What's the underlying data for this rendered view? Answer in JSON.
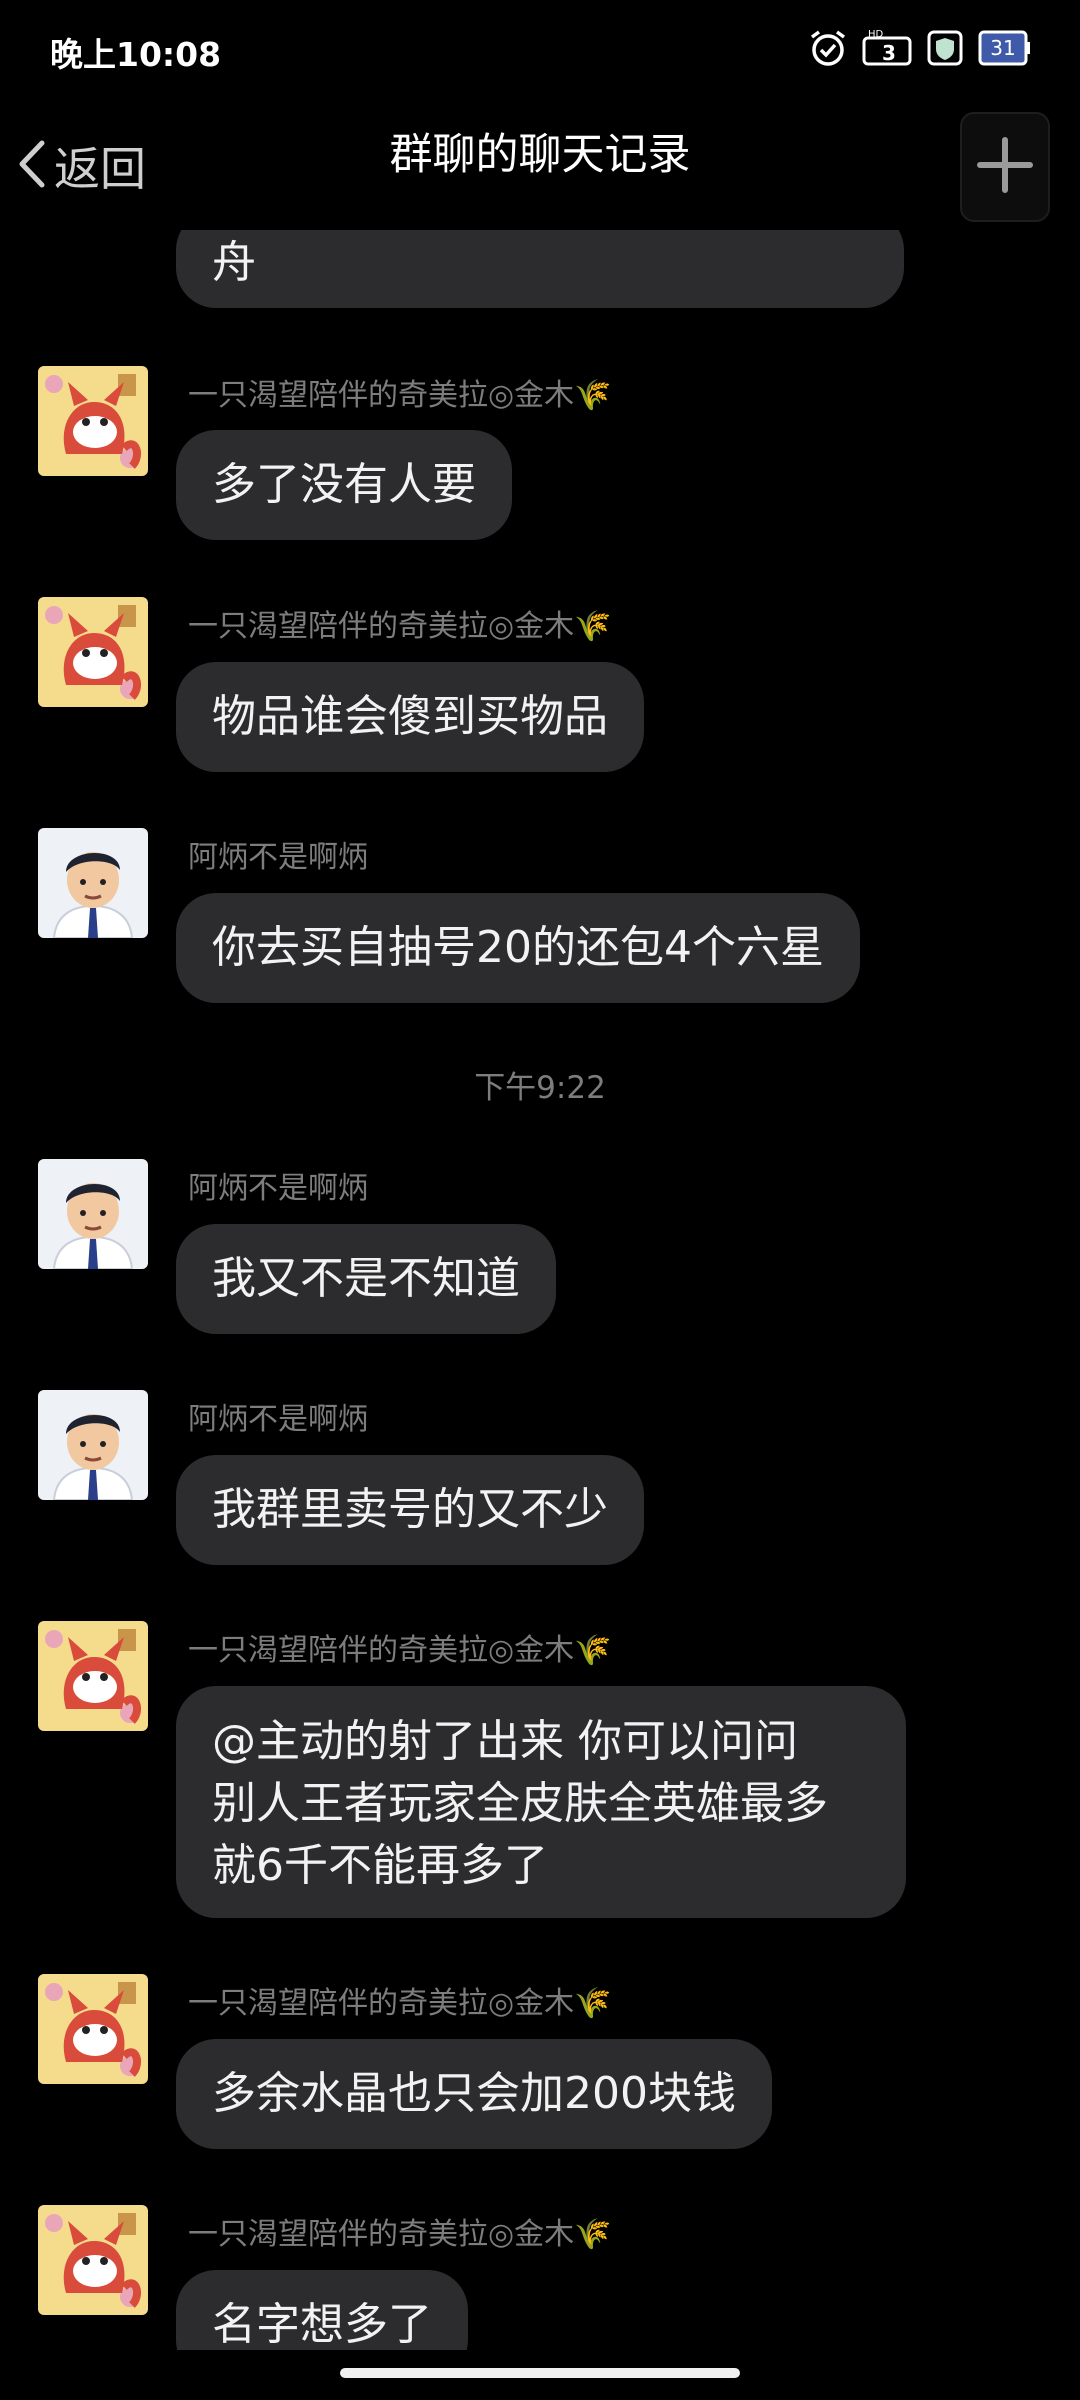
{
  "status_bar": {
    "time": "晚上10:08",
    "battery_text": "31",
    "network_label": "HD"
  },
  "nav": {
    "back_label": "返回",
    "title": "群聊的聊天记录"
  },
  "messages": [
    {
      "text": "舟"
    },
    {
      "sender": "一只渴望陪伴的奇美拉◎金木🌾",
      "text": "多了没有人要"
    },
    {
      "sender": "一只渴望陪伴的奇美拉◎金木🌾",
      "text": "物品谁会傻到买物品"
    },
    {
      "sender": "阿炳不是啊炳",
      "text": "你去买自抽号20的还包4个六星"
    },
    {
      "time": "下午9:22"
    },
    {
      "sender": "阿炳不是啊炳",
      "text": "我又不是不知道"
    },
    {
      "sender": "阿炳不是啊炳",
      "text": "我群里卖号的又不少"
    },
    {
      "sender": "一只渴望陪伴的奇美拉◎金木🌾",
      "text": "@主动的射了出来 你可以问问\n别人王者玩家全皮肤全英雄最多\n就6千不能再多了"
    },
    {
      "sender": "一只渴望陪伴的奇美拉◎金木🌾",
      "text": "多余水晶也只会加200块钱"
    },
    {
      "sender": "一只渴望陪伴的奇美拉◎金木🌾",
      "text": "名字想多了"
    }
  ],
  "colors": {
    "background": "#000000",
    "bubble": "#2c2c2e",
    "sender": "#7d7d7d",
    "text": "#f2f2f2"
  }
}
